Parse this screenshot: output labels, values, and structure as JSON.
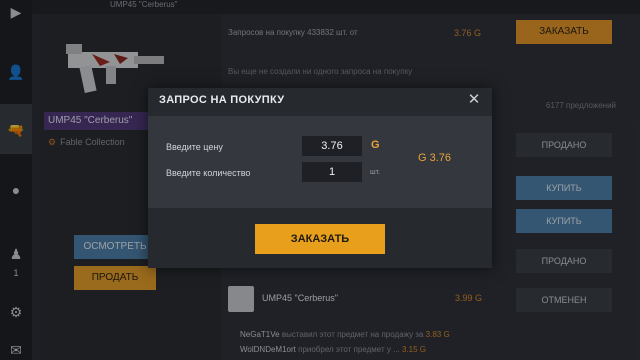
{
  "topbar": {
    "text": "UMP45 \"Cerberus\""
  },
  "sidebar": {
    "items": [
      {
        "icon": "play-icon",
        "glyph": "▶"
      },
      {
        "icon": "user-icon",
        "glyph": "👤"
      },
      {
        "icon": "gun-icon",
        "glyph": "🔫"
      },
      {
        "icon": "grenade-icon",
        "glyph": "●"
      },
      {
        "icon": "player-icon",
        "glyph": "♟"
      },
      {
        "icon": "gear-icon",
        "glyph": "⚙"
      },
      {
        "icon": "mail-icon",
        "glyph": "✉"
      }
    ],
    "count": "1"
  },
  "item": {
    "name": "UMP45 \"Cerberus\"",
    "collection": "Fable Collection",
    "view_label": "ОСМОТРЕТЬ",
    "sell_label": "ПРОДАТЬ"
  },
  "requests": {
    "summary": "Запросов на покупку 433832 шт. от",
    "min_price": "3.76 G",
    "order_label": "ЗАКАЗАТЬ",
    "no_requests": "Вы еще не создали ни одного запроса на покупку",
    "offers": "6177 предложений",
    "sold_label": "ПРОДАНО",
    "buy_label": "КУПИТЬ",
    "cancel_label": "ОТМЕНЕН",
    "row_name": "UMP45 \"Cerberus\"",
    "row_price": "3.99 G"
  },
  "feed": [
    {
      "user": "NeGaT1Ve",
      "text": "выставил этот предмет на продажу за",
      "price": "3.83 G"
    },
    {
      "user": "WolDNDeM1ort",
      "text": "приобрел этот предмет у ...",
      "price": "3.15 G"
    }
  ],
  "modal": {
    "title": "ЗАПРОС НА ПОКУПКУ",
    "close": "✕",
    "price_label": "Введите цену",
    "price_value": "3.76",
    "currency": "G",
    "qty_label": "Введите количество",
    "qty_value": "1",
    "qty_unit": "шт.",
    "total": "G 3.76",
    "order_label": "ЗАКАЗАТЬ"
  },
  "colors": {
    "accent": "#e8a01c",
    "blue": "#4d7fa8",
    "rarity": "#4f3a7a"
  }
}
